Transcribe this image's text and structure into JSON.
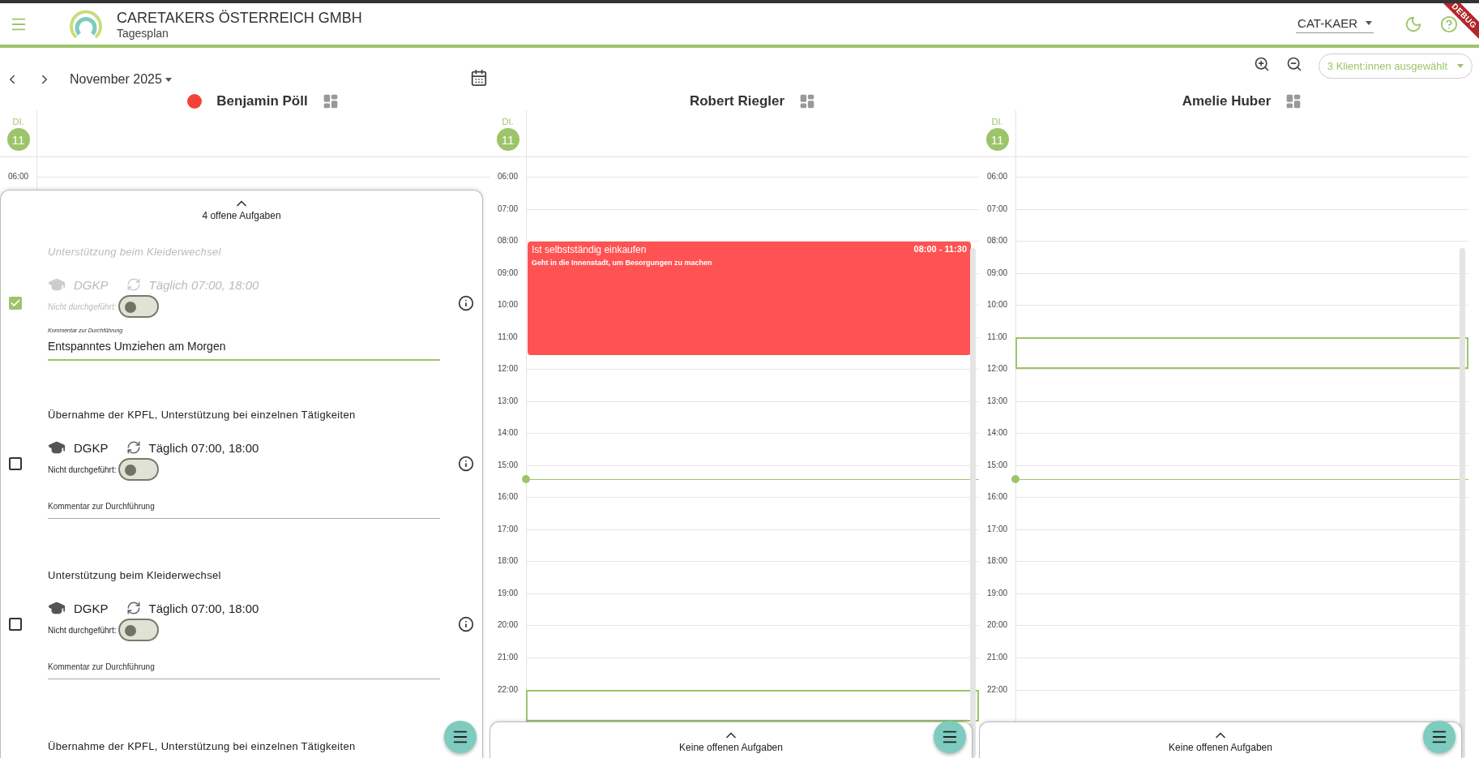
{
  "header": {
    "company": "CARETAKERS ÖSTERREICH GMBH",
    "page": "Tagesplan",
    "site": "CAT-KAER",
    "debug_label": "DEBUG"
  },
  "toolbar": {
    "month": "November 2025",
    "client_filter": "3 Klient:innen ausgewählt"
  },
  "columns": [
    {
      "client": "Benjamin Pöll",
      "flagged": true,
      "weekday": "DI.",
      "day": "11",
      "hours": [
        {
          "label": "06:00",
          "selected": false
        }
      ],
      "task_panel": {
        "expanded": true,
        "summary": "4 offene Aufgaben",
        "tasks": [
          {
            "title": "Unterstützung beim Kleiderwechsel",
            "done": true,
            "qualification": "DGKP",
            "schedule": "Täglich 07:00, 18:00",
            "not_performed_label": "Nicht durchgeführt:",
            "not_performed": false,
            "comment": {
              "label": "Kommentar zur Durchführung",
              "value": "Entspanntes Umziehen am Morgen"
            }
          },
          {
            "title": "Übernahme der KPFL, Unterstützung bei einzelnen Tätigkeiten",
            "done": false,
            "qualification": "DGKP",
            "schedule": "Täglich 07:00, 18:00",
            "not_performed_label": "Nicht durchgeführt:",
            "not_performed": false,
            "comment": {
              "placeholder": "Kommentar zur Durchführung"
            }
          },
          {
            "title": "Unterstützung beim Kleiderwechsel",
            "done": false,
            "qualification": "DGKP",
            "schedule": "Täglich 07:00, 18:00",
            "not_performed_label": "Nicht durchgeführt:",
            "not_performed": false,
            "comment": {
              "placeholder": "Kommentar zur Durchführung"
            }
          },
          {
            "title": "Übernahme der KPFL, Unterstützung bei einzelnen Tätigkeiten"
          }
        ]
      }
    },
    {
      "client": "Robert Riegler",
      "flagged": false,
      "weekday": "DI.",
      "day": "11",
      "now_line": true,
      "hours": [
        {
          "label": "06:00",
          "selected": false
        },
        {
          "label": "07:00",
          "selected": false
        },
        {
          "label": "08:00",
          "selected": false
        },
        {
          "label": "09:00",
          "selected": false
        },
        {
          "label": "10:00",
          "selected": false
        },
        {
          "label": "11:00",
          "selected": false
        },
        {
          "label": "12:00",
          "selected": false
        },
        {
          "label": "13:00",
          "selected": false
        },
        {
          "label": "14:00",
          "selected": false
        },
        {
          "label": "15:00",
          "selected": false
        },
        {
          "label": "16:00",
          "selected": false
        },
        {
          "label": "17:00",
          "selected": false
        },
        {
          "label": "18:00",
          "selected": false
        },
        {
          "label": "19:00",
          "selected": false
        },
        {
          "label": "20:00",
          "selected": false
        },
        {
          "label": "21:00",
          "selected": false
        },
        {
          "label": "22:00",
          "selected": true
        }
      ],
      "events": [
        {
          "title": "Ist selbstständig einkaufen",
          "description": "Geht in die Innenstadt, um Besorgungen zu machen",
          "time": "08:00 - 11:30",
          "color": "#ff5252"
        }
      ],
      "task_panel": {
        "expanded": false,
        "summary": "Keine offenen Aufgaben"
      }
    },
    {
      "client": "Amelie Huber",
      "flagged": false,
      "weekday": "DI.",
      "day": "11",
      "now_line": true,
      "hours": [
        {
          "label": "06:00",
          "selected": false
        },
        {
          "label": "07:00",
          "selected": false
        },
        {
          "label": "08:00",
          "selected": false
        },
        {
          "label": "09:00",
          "selected": false
        },
        {
          "label": "10:00",
          "selected": false
        },
        {
          "label": "11:00",
          "selected": true
        },
        {
          "label": "12:00",
          "selected": false
        },
        {
          "label": "13:00",
          "selected": false
        },
        {
          "label": "14:00",
          "selected": false
        },
        {
          "label": "15:00",
          "selected": false
        },
        {
          "label": "16:00",
          "selected": false
        },
        {
          "label": "17:00",
          "selected": false
        },
        {
          "label": "18:00",
          "selected": false
        },
        {
          "label": "19:00",
          "selected": false
        },
        {
          "label": "20:00",
          "selected": false
        },
        {
          "label": "21:00",
          "selected": false
        },
        {
          "label": "22:00",
          "selected": false
        }
      ],
      "task_panel": {
        "expanded": false,
        "summary": "Keine offenen Aufgaben"
      }
    }
  ]
}
